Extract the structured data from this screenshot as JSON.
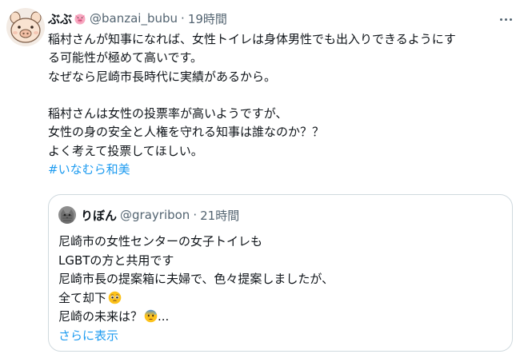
{
  "tweet": {
    "author_name": "ぶぶ",
    "author_handle": "@banzai_bubu",
    "separator": "·",
    "time": "19時間",
    "lines": [
      "稲村さんが知事になれば、女性トイレは身体男性でも出入りできるようにす",
      "る可能性が極めて高いです。",
      "なぜなら尼崎市長時代に実績があるから。",
      "",
      "稲村さんは女性の投票率が高いようですが、",
      "女性の身の安全と人権を守れる知事は誰なのか？？",
      "よく考えて投票してほしい。"
    ],
    "hashtag": "#いなむら和美"
  },
  "quote": {
    "author_name": "りぼん",
    "author_handle": "@grayribon",
    "separator": "·",
    "time": "21時間",
    "lines": [
      "尼崎市の女性センターの女子トイレも",
      "LGBTの方と共用です",
      "尼崎市長の提案箱に夫婦で、色々提案しましたが、",
      "全て却下",
      "尼崎の未来は？",
      "..."
    ],
    "show_more": "さらに表示"
  },
  "colors": {
    "text": "#0f1419",
    "secondary": "#536471",
    "link": "#1d9bf0",
    "border": "#cfd9de"
  },
  "icons": {
    "more": "more-dots-icon",
    "pig": "pig-face-icon",
    "pleading": "pleading-face-icon",
    "anxious": "anxious-face-icon"
  }
}
